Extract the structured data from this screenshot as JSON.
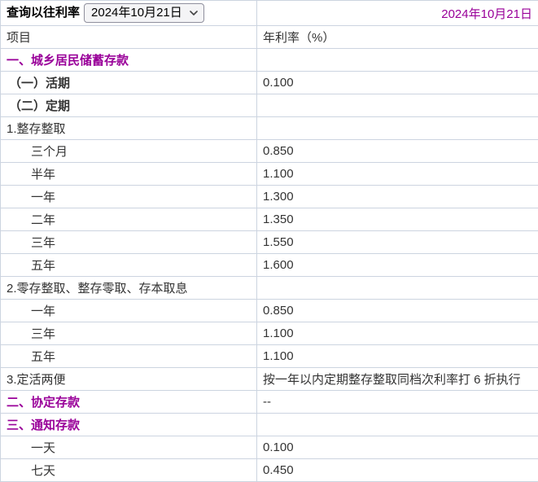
{
  "colors": {
    "accent": "#990099",
    "border": "#ccd4e0",
    "text": "#333333",
    "select_bg": "#f4f4f6"
  },
  "toolbar": {
    "query_label": "查询以往利率",
    "date_select_value": "2024年10月21日",
    "date_display": "2024年10月21日"
  },
  "table": {
    "headers": {
      "item": "项目",
      "rate": "年利率（%）"
    },
    "rows": [
      {
        "item": "一、城乡居民储蓄存款",
        "rate": "",
        "variant": "section"
      },
      {
        "item": "（一）活期",
        "rate": "0.100",
        "variant": "subsection"
      },
      {
        "item": "（二）定期",
        "rate": "",
        "variant": "subsection"
      },
      {
        "item": "1.整存整取",
        "rate": "",
        "variant": "group"
      },
      {
        "item": "三个月",
        "rate": "0.850",
        "variant": "leaf"
      },
      {
        "item": "半年",
        "rate": "1.100",
        "variant": "leaf"
      },
      {
        "item": "一年",
        "rate": "1.300",
        "variant": "leaf"
      },
      {
        "item": "二年",
        "rate": "1.350",
        "variant": "leaf"
      },
      {
        "item": "三年",
        "rate": "1.550",
        "variant": "leaf"
      },
      {
        "item": "五年",
        "rate": "1.600",
        "variant": "leaf"
      },
      {
        "item": "2.零存整取、整存零取、存本取息",
        "rate": "",
        "variant": "group"
      },
      {
        "item": "一年",
        "rate": "0.850",
        "variant": "leaf"
      },
      {
        "item": "三年",
        "rate": "1.100",
        "variant": "leaf"
      },
      {
        "item": "五年",
        "rate": "1.100",
        "variant": "leaf"
      },
      {
        "item": "3.定活两便",
        "rate": "按一年以内定期整存整取同档次利率打 6 折执行",
        "variant": "group"
      },
      {
        "item": "二、协定存款",
        "rate": "--",
        "variant": "section"
      },
      {
        "item": "三、通知存款",
        "rate": "",
        "variant": "section"
      },
      {
        "item": "一天",
        "rate": "0.100",
        "variant": "leaf"
      },
      {
        "item": "七天",
        "rate": "0.450",
        "variant": "leaf"
      }
    ]
  }
}
